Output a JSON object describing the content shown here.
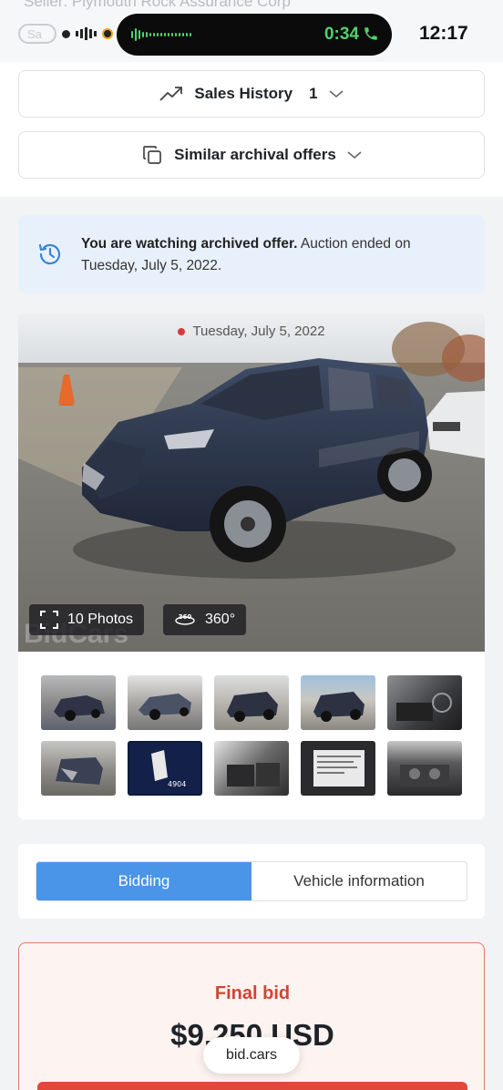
{
  "status_bar": {
    "seller_text": "Seller: Plymouth Rock Assurance Corp",
    "call_time": "0:34",
    "clock": "12:17"
  },
  "top_panel": {
    "sales_history_label": "Sales History",
    "sales_history_count": "1",
    "similar_offers_label": "Similar archival offers"
  },
  "info_banner": {
    "bold_text": "You are watching archived offer.",
    "text": " Auction ended on Tuesday, July 5, 2022."
  },
  "gallery": {
    "date": "Tuesday, July 5, 2022",
    "photos_label": "10 Photos",
    "view360_label": "360°",
    "watermark": "BidCars",
    "thumbnails": [
      "front-left damage",
      "front-left lot",
      "rear-left",
      "rear-left sky",
      "interior dashboard",
      "front damage",
      "odometer display",
      "rear seats",
      "window sticker",
      "engine bay"
    ]
  },
  "tabs": {
    "bidding": "Bidding",
    "vehicle_info": "Vehicle information"
  },
  "bid": {
    "label": "Final bid",
    "amount": "$9,250 USD"
  },
  "url_bar": {
    "domain": "bid.cars"
  },
  "colors": {
    "accent_blue": "#4a95e8",
    "final_bid_red": "#d04535",
    "call_green": "#4fd36a",
    "banner_bg": "#e8f1fb"
  }
}
